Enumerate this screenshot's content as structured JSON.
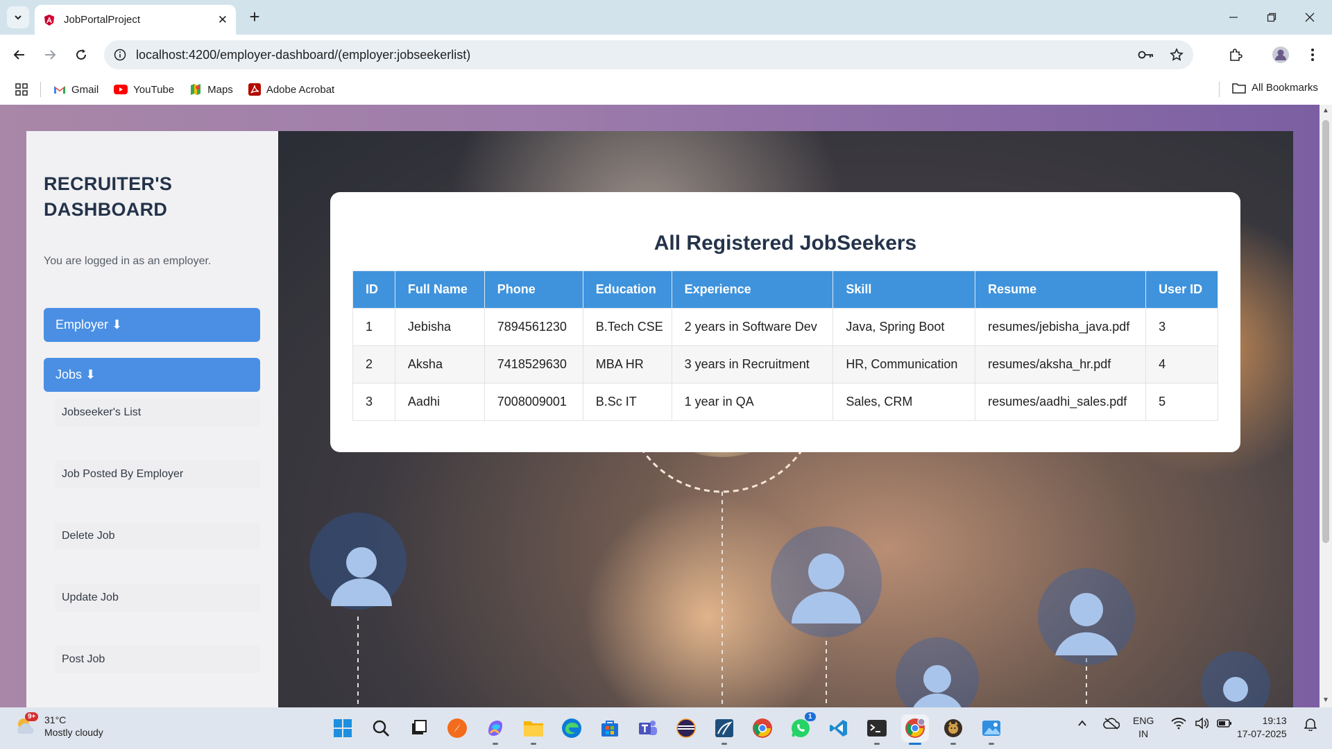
{
  "browser": {
    "tab_title": "JobPortalProject",
    "url": "localhost:4200/employer-dashboard/(employer:jobseekerlist)",
    "bookmarks": [
      {
        "label": "Gmail",
        "icon": "gmail-icon"
      },
      {
        "label": "YouTube",
        "icon": "youtube-icon"
      },
      {
        "label": "Maps",
        "icon": "maps-icon"
      },
      {
        "label": "Adobe Acrobat",
        "icon": "acrobat-icon"
      }
    ],
    "all_bookmarks": "All Bookmarks"
  },
  "sidebar": {
    "title_line1": "RECRUITER'S",
    "title_line2": "DASHBOARD",
    "note": "You are logged in as an employer.",
    "employer_button": "Employer ⬇",
    "jobs_button": "Jobs ⬇",
    "sub_items": [
      "Jobseeker's List",
      "Job Posted By Employer",
      "Delete Job",
      "Update Job",
      "Post Job"
    ]
  },
  "main": {
    "heading": "All Registered JobSeekers",
    "columns": [
      "ID",
      "Full Name",
      "Phone",
      "Education",
      "Experience",
      "Skill",
      "Resume",
      "User ID"
    ],
    "rows": [
      [
        "1",
        "Jebisha",
        "7894561230",
        "B.Tech CSE",
        "2 years in Software Dev",
        "Java, Spring Boot",
        "resumes/jebisha_java.pdf",
        "3"
      ],
      [
        "2",
        "Aksha",
        "7418529630",
        "MBA HR",
        "3 years in Recruitment",
        "HR, Communication",
        "resumes/aksha_hr.pdf",
        "4"
      ],
      [
        "3",
        "Aadhi",
        "7008009001",
        "B.Sc IT",
        "1 year in QA",
        "Sales, CRM",
        "resumes/aadhi_sales.pdf",
        "5"
      ]
    ]
  },
  "taskbar": {
    "weather_temp": "31°C",
    "weather_desc": "Mostly cloudy",
    "weather_badge": "9+",
    "whatsapp_badge": "1",
    "lang_line1": "ENG",
    "lang_line2": "IN",
    "time": "19:13",
    "date": "17-07-2025"
  },
  "colors": {
    "accent_blue": "#4a8fe4",
    "table_header": "#3f93dc",
    "heading_navy": "#24334a"
  }
}
